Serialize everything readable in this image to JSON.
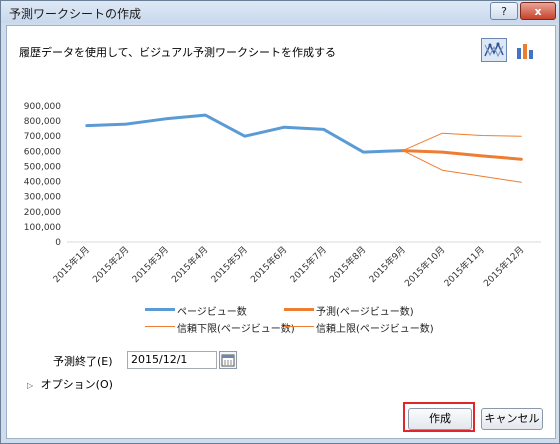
{
  "window": {
    "title": "予測ワークシートの作成",
    "help_label": "?",
    "close_label": "x"
  },
  "description": "履歴データを使用して、ビジュアル予測ワークシートを作成する",
  "chart_type_buttons": [
    {
      "name": "line-chart",
      "selected": true
    },
    {
      "name": "column-chart",
      "selected": false
    }
  ],
  "chart_data": {
    "type": "line",
    "categories": [
      "2015年1月",
      "2015年2月",
      "2015年3月",
      "2015年4月",
      "2015年5月",
      "2015年6月",
      "2015年7月",
      "2015年8月",
      "2015年9月",
      "2015年10月",
      "2015年11月",
      "2015年12月"
    ],
    "y_ticks": [
      "0",
      "100,000",
      "200,000",
      "300,000",
      "400,000",
      "500,000",
      "600,000",
      "700,000",
      "800,000",
      "900,000"
    ],
    "ylim": [
      0,
      900000
    ],
    "series": [
      {
        "name": "ページビュー数",
        "color": "#5b9bd5",
        "values": [
          770000,
          780000,
          815000,
          840000,
          700000,
          760000,
          745000,
          595000,
          605000,
          null,
          null,
          null
        ]
      },
      {
        "name": "予測(ページビュー数)",
        "color": "#ed7d31",
        "values": [
          null,
          null,
          null,
          null,
          null,
          null,
          null,
          null,
          605000,
          595000,
          570000,
          548000
        ]
      },
      {
        "name": "信頼下限(ページビュー数)",
        "color": "#ed7d31",
        "values": [
          null,
          null,
          null,
          null,
          null,
          null,
          null,
          null,
          605000,
          475000,
          435000,
          395000
        ]
      },
      {
        "name": "信頼上限(ページビュー数)",
        "color": "#ed7d31",
        "values": [
          null,
          null,
          null,
          null,
          null,
          null,
          null,
          null,
          605000,
          720000,
          705000,
          700000
        ]
      }
    ]
  },
  "legend": {
    "historical": "ページビュー数",
    "forecast": "予測(ページビュー数)",
    "lower": "信頼下限(ページビュー数)",
    "upper": "信頼上限(ページビュー数)"
  },
  "forecast_end": {
    "label": "予測終了(E)",
    "value": "2015/12/1"
  },
  "options_label": "オプション(O)",
  "buttons": {
    "create": "作成",
    "cancel": "キャンセル"
  }
}
